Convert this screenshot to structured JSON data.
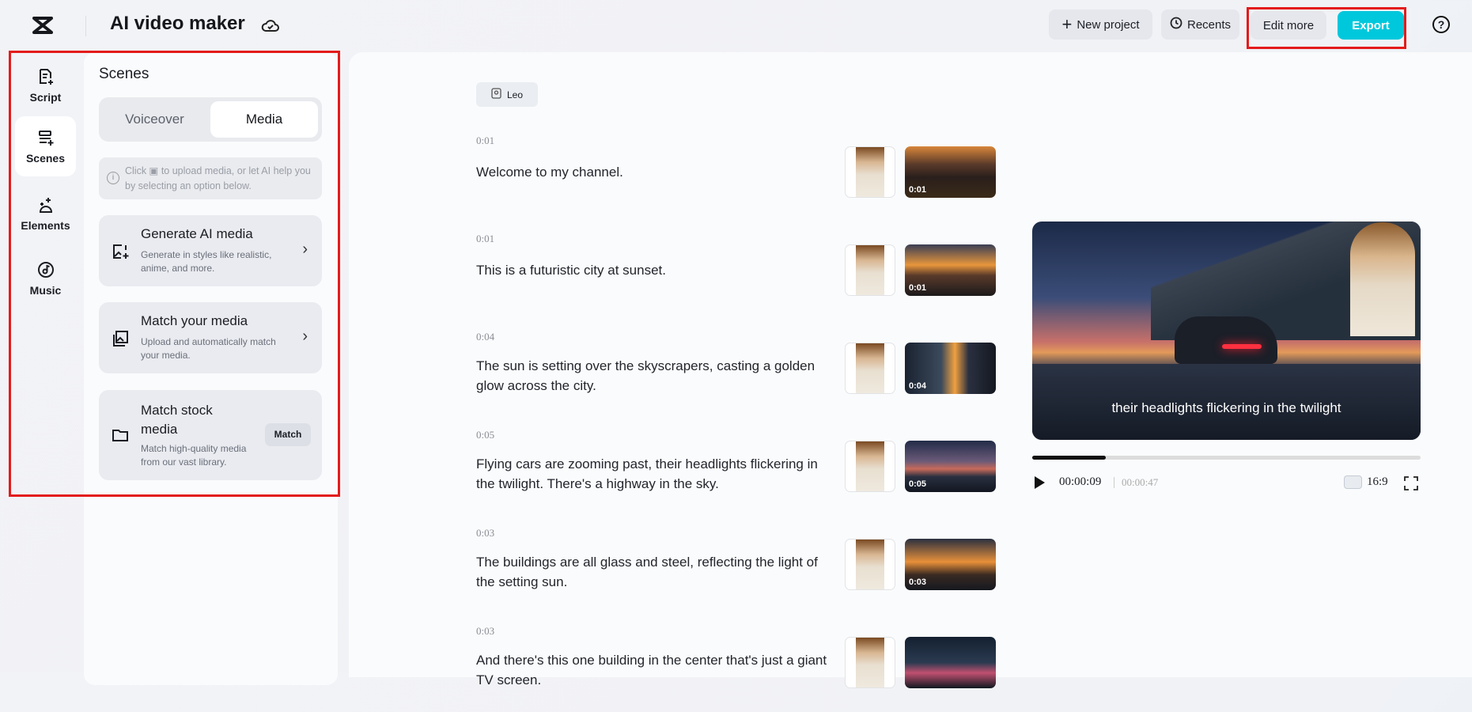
{
  "header": {
    "title": "AI video maker",
    "new_project": "New project",
    "recents": "Recents",
    "edit_more": "Edit more",
    "export": "Export"
  },
  "rail": [
    {
      "label": "Script"
    },
    {
      "label": "Scenes"
    },
    {
      "label": "Elements"
    },
    {
      "label": "Music"
    }
  ],
  "panel": {
    "title": "Scenes",
    "tabs": [
      "Voiceover",
      "Media"
    ],
    "info": "Click ▣ to upload media, or let AI help you by selecting an option below.",
    "cards": [
      {
        "title": "Generate AI media",
        "desc": "Generate in styles like realistic, anime, and more."
      },
      {
        "title": "Match your media",
        "desc": "Upload and automatically match your media."
      },
      {
        "title": "Match stock media",
        "desc": "Match high-quality media from our vast library.",
        "button": "Match"
      }
    ]
  },
  "avatar_chip": "Leo",
  "scenes": [
    {
      "time": "0:01",
      "text": "Welcome to my channel.",
      "clip": "0:01"
    },
    {
      "time": "0:01",
      "text": "This is a futuristic city at sunset.",
      "clip": "0:01"
    },
    {
      "time": "0:04",
      "text": "The sun is setting over the skyscrapers, casting a golden glow across the city.",
      "clip": "0:04"
    },
    {
      "time": "0:05",
      "text": "Flying cars are zooming past, their headlights flickering in the twilight. There's a highway in the sky.",
      "clip": "0:05"
    },
    {
      "time": "0:03",
      "text": "The buildings are all glass and steel, reflecting the light of the setting sun.",
      "clip": "0:03"
    },
    {
      "time": "0:03",
      "text": "And there's this one building in the center that's just a giant TV screen.",
      "clip": ""
    }
  ],
  "player": {
    "caption": "their headlights flickering in the twilight",
    "current": "00:00:09",
    "total": "00:00:47",
    "progress": 0.19,
    "ratio": "16:9"
  },
  "colors": {
    "accent": "#00c8dc",
    "highlight": "#e41b1b"
  }
}
